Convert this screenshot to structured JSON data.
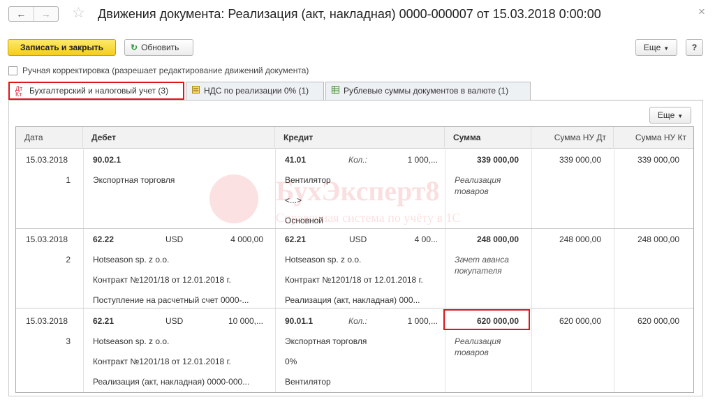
{
  "window": {
    "title": "Движения документа: Реализация (акт, накладная) 0000-000007 от 15.03.2018 0:00:00",
    "back_icon": "arrow-left-icon",
    "forward_icon": "arrow-right-icon",
    "favorite_icon": "star-icon",
    "close_icon": "close-icon"
  },
  "toolbar": {
    "save_close_label": "Записать и закрыть",
    "refresh_label": "Обновить",
    "more_label": "Еще",
    "help_label": "?"
  },
  "manual_edit": {
    "label": "Ручная корректировка (разрешает редактирование движений документа)",
    "checked": false
  },
  "tabs": [
    {
      "label": "Бухгалтерский и налоговый учет (3)",
      "icon": "dt-kt-icon",
      "active": true
    },
    {
      "label": "НДС по реализации 0% (1)",
      "icon": "register-icon",
      "active": false
    },
    {
      "label": "Рублевые суммы документов в валюте (1)",
      "icon": "grid-icon",
      "active": false
    }
  ],
  "table_more_label": "Еще",
  "columns": {
    "date": "Дата",
    "debit": "Дебет",
    "credit": "Кредит",
    "sum": "Сумма",
    "sum_nu_dt": "Сумма НУ Дт",
    "sum_nu_kt": "Сумма НУ Кт"
  },
  "rows": [
    {
      "date": "15.03.2018",
      "num": "1",
      "debit_account": "90.02.1",
      "debit_currency": "",
      "debit_amount": "",
      "debit_lines": [
        "Экспортная торговля",
        "",
        ""
      ],
      "credit_account": "41.01",
      "credit_currency": "Кол.:",
      "credit_amount": "1 000,...",
      "credit_lines": [
        "Вентилятор",
        "<...>",
        "Основной"
      ],
      "sum": "339 000,00",
      "sum_note": "Реализация товаров",
      "sum_nu_dt": "339 000,00",
      "sum_nu_kt": "339 000,00"
    },
    {
      "date": "15.03.2018",
      "num": "2",
      "debit_account": "62.22",
      "debit_currency": "USD",
      "debit_amount": "4 000,00",
      "debit_lines": [
        "Hotseason sp. z o.o.",
        "Контракт №1201/18 от 12.01.2018 г.",
        "Поступление на расчетный счет 0000-..."
      ],
      "credit_account": "62.21",
      "credit_currency": "USD",
      "credit_amount": "4 00...",
      "credit_lines": [
        "Hotseason sp. z o.o.",
        "Контракт №1201/18 от 12.01.2018 г.",
        "Реализация (акт, накладная) 000..."
      ],
      "sum": "248 000,00",
      "sum_note": "Зачет аванса покупателя",
      "sum_nu_dt": "248 000,00",
      "sum_nu_kt": "248 000,00"
    },
    {
      "date": "15.03.2018",
      "num": "3",
      "debit_account": "62.21",
      "debit_currency": "USD",
      "debit_amount": "10 000,...",
      "debit_lines": [
        "Hotseason sp. z o.o.",
        "Контракт №1201/18 от 12.01.2018 г.",
        "Реализация (акт, накладная) 0000-000..."
      ],
      "credit_account": "90.01.1",
      "credit_currency": "Кол.:",
      "credit_amount": "1 000,...",
      "credit_lines": [
        "Экспортная торговля",
        "0%",
        "Вентилятор"
      ],
      "sum": "620 000,00",
      "sum_note": "Реализация товаров",
      "sum_nu_dt": "620 000,00",
      "sum_nu_kt": "620 000,00"
    }
  ],
  "watermark": {
    "brand": "БухЭксперт8",
    "tagline": "Справочная система по учёту в 1С"
  },
  "colors": {
    "primary_button": "#f5cd1c",
    "highlight": "#e0151b",
    "refresh_icon": "#2a9b3c"
  }
}
